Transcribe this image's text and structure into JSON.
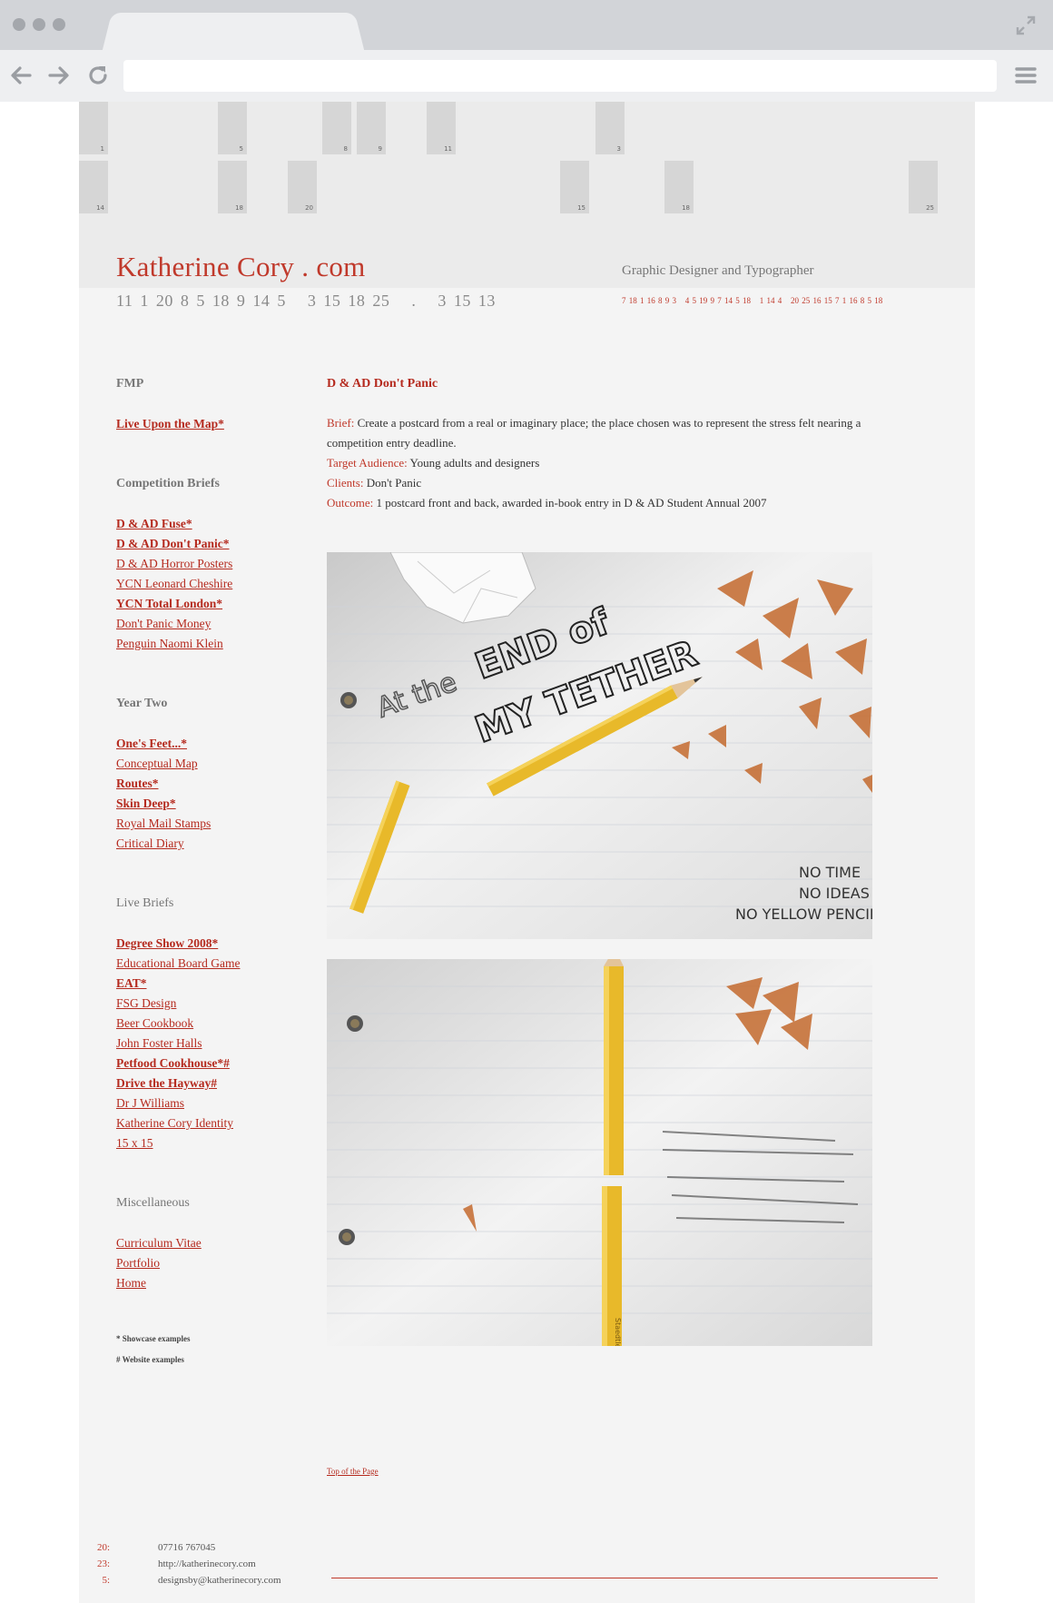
{
  "number_grid": {
    "row1": [
      "1",
      "5",
      "8",
      "9",
      "11",
      "3"
    ],
    "row2": [
      "14",
      "18",
      "20",
      "15",
      "18",
      "25"
    ]
  },
  "header": {
    "title": "Katherine Cory . com",
    "title_code": "11 1 20 8 5 18 9 14 5   3 15 18 25   .   3 15 13",
    "tagline": "Graphic Designer and Typographer",
    "tagline_code": "7 18 1 16 8 9 3   4 5 19 9 7 14 5 18   1 14 4   20 25 16 15 7 1 16 8 5 18"
  },
  "sidebar": {
    "fmp": {
      "heading": "FMP",
      "items": [
        {
          "label": "Live Upon the Map*",
          "bold": true
        }
      ]
    },
    "competition": {
      "heading": "Competition Briefs",
      "items": [
        {
          "label": "D & AD Fuse*",
          "bold": true
        },
        {
          "label": "D & AD Don't Panic*",
          "bold": true
        },
        {
          "label": "D & AD Horror Posters",
          "bold": false
        },
        {
          "label": "YCN Leonard Cheshire",
          "bold": false
        },
        {
          "label": "YCN Total London*",
          "bold": true
        },
        {
          "label": "Don't Panic Money",
          "bold": false
        },
        {
          "label": "Penguin Naomi Klein",
          "bold": false
        }
      ]
    },
    "year_two": {
      "heading": "Year Two",
      "items": [
        {
          "label": "One's Feet...*",
          "bold": true
        },
        {
          "label": "Conceptual Map",
          "bold": false
        },
        {
          "label": "Routes*",
          "bold": true
        },
        {
          "label": "Skin Deep*",
          "bold": true
        },
        {
          "label": "Royal Mail Stamps",
          "bold": false
        },
        {
          "label": "Critical Diary",
          "bold": false
        }
      ]
    },
    "live": {
      "heading": "Live Briefs",
      "items": [
        {
          "label": "Degree Show 2008*",
          "bold": true
        },
        {
          "label": "Educational Board Game",
          "bold": false
        },
        {
          "label": "EAT*",
          "bold": true
        },
        {
          "label": "FSG Design",
          "bold": false
        },
        {
          "label": "Beer Cookbook",
          "bold": false
        },
        {
          "label": "John Foster Halls",
          "bold": false
        },
        {
          "label": "Petfood Cookhouse*#",
          "bold": true
        },
        {
          "label": "Drive the Hayway#",
          "bold": true
        },
        {
          "label": "Dr J Williams",
          "bold": false
        },
        {
          "label": "Katherine Cory Identity",
          "bold": false
        },
        {
          "label": "15 x 15",
          "bold": false
        }
      ]
    },
    "misc": {
      "heading": "Miscellaneous",
      "items": [
        {
          "label": "Curriculum Vitae",
          "bold": false
        },
        {
          "label": "Portfolio",
          "bold": false
        },
        {
          "label": "Home",
          "bold": false
        }
      ]
    },
    "legend": {
      "showcase": "* Showcase examples",
      "website": "# Website examples"
    }
  },
  "main": {
    "title": "D & AD Don't Panic",
    "brief_key": "Brief:",
    "brief_line1": "Create a postcard from a real or imaginary place; the place chosen was to represent the stress felt nearing a",
    "brief_line2": "competition entry deadline.",
    "audience_key": "Target Audience:",
    "audience": "Young adults and designers",
    "clients_key": "Clients:",
    "clients": "Don't Panic",
    "outcome_key": "Outcome:",
    "outcome": "1 postcard front and back, awarded in-book entry in D & AD Student Annual 2007",
    "postcard_front": {
      "headline_small": "At the",
      "headline_big1": "END of",
      "headline_big2": "MY TETHER",
      "note1": "NO TIME",
      "note2": "NO IDEAS",
      "note3": "NO YELLOW PENCIL"
    },
    "postcard_back": {
      "pencil_label": "Staedtler"
    },
    "top_link": "Top of the Page"
  },
  "footer": {
    "phone_num": "20:",
    "phone": "07716 767045",
    "web_num": "23:",
    "web": "http://katherinecory.com",
    "email_num": "5:",
    "email": "designsby@katherinecory.com"
  },
  "colors": {
    "accent": "#c0392b",
    "page_bg": "#f4f4f4",
    "header_bg": "#ebebeb",
    "tile": "#d6d6d6"
  }
}
